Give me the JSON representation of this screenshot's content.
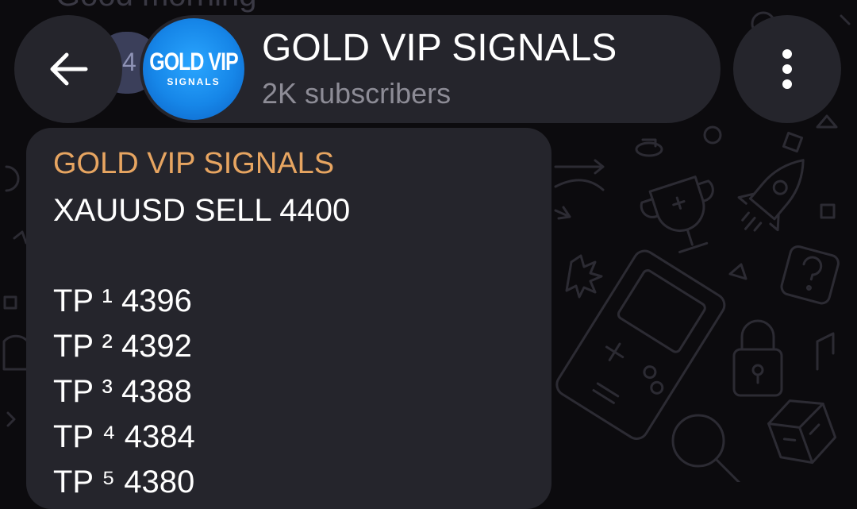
{
  "background_hint": {
    "partial_text": "Good morning",
    "partial_badge": "4"
  },
  "header": {
    "channel_name": "GOLD VIP SIGNALS",
    "subscribers": "2K subscribers",
    "avatar": {
      "logo_main": "GOLD VIP",
      "logo_sub": "SIGNALS",
      "color": "#1a8cf0"
    },
    "back_icon": "arrow-left-icon",
    "menu_icon": "vertical-dots-icon"
  },
  "message": {
    "channel_label": "GOLD VIP SIGNALS",
    "signal": "XAUUSD SELL 4400",
    "targets": [
      "TP ¹ 4396",
      "TP ² 4392",
      "TP ³ 4388",
      "TP ⁴ 4384",
      "TP ⁵ 4380"
    ]
  },
  "colors": {
    "background": "#0c0b0e",
    "surface": "#25252c",
    "accent_orange": "#e7a561",
    "muted_text": "#8d8c96"
  }
}
